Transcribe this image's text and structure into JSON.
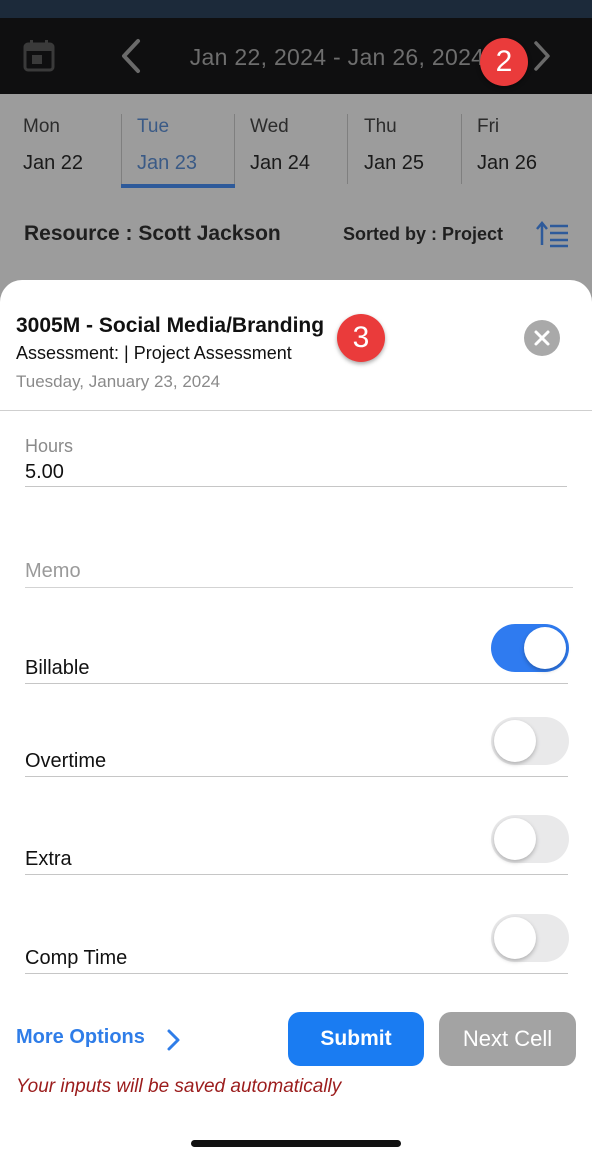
{
  "header": {
    "date_range": "Jan 22, 2024 - Jan 26, 2024",
    "icons": {
      "calendar": "calendar-icon",
      "prev": "chevron-left-icon",
      "next": "chevron-right-icon"
    },
    "background_color": "#0f0f10"
  },
  "annotations": {
    "badge_2": "2",
    "badge_3": "3",
    "badge_color": "#ea3b3b"
  },
  "days": [
    {
      "name": "Mon",
      "date": "Jan 22"
    },
    {
      "name": "Tue",
      "date": "Jan 23"
    },
    {
      "name": "Wed",
      "date": "Jan 24"
    },
    {
      "name": "Thu",
      "date": "Jan 25"
    },
    {
      "name": "Fri",
      "date": "Jan 26"
    }
  ],
  "selected_day": "Tue",
  "resource": {
    "label": "Resource :  Scott Jackson",
    "sort_label": "Sorted by : Project",
    "sort_icon": "sort-icon"
  },
  "sheet": {
    "title": "3005M - Social Media/Branding",
    "subtitle": "Assessment: | Project Assessment",
    "date": "Tuesday, January 23, 2024",
    "close_icon": "close-icon"
  },
  "form": {
    "hours_label": "Hours",
    "hours_value": "5.00",
    "memo_placeholder": "Memo",
    "memo_value": "",
    "toggles": [
      {
        "label": "Billable",
        "on": true
      },
      {
        "label": "Overtime",
        "on": false
      },
      {
        "label": "Extra",
        "on": false
      },
      {
        "label": "Comp Time",
        "on": false
      }
    ]
  },
  "actions": {
    "more_options": "More Options",
    "submit": "Submit",
    "next_cell": "Next Cell",
    "auto_save_note": "Your inputs will be saved automatically"
  },
  "colors": {
    "accent": "#1a7cf2",
    "toggle_on": "#2f7bf0",
    "note": "#9b1c1c"
  }
}
